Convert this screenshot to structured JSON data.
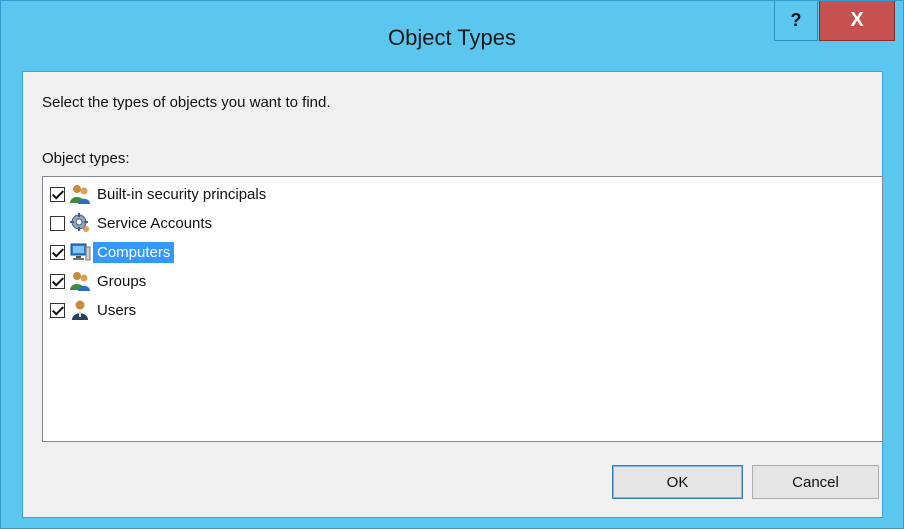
{
  "window": {
    "title": "Object Types",
    "help_label": "?",
    "close_label": "X"
  },
  "dialog": {
    "prompt": "Select the types of objects you want to find.",
    "list_label": "Object types:"
  },
  "object_types": [
    {
      "label": "Built-in security principals",
      "checked": true,
      "selected": false,
      "icon": "users-group-icon"
    },
    {
      "label": "Service Accounts",
      "checked": false,
      "selected": false,
      "icon": "service-account-gear-icon"
    },
    {
      "label": "Computers",
      "checked": true,
      "selected": true,
      "icon": "computer-icon"
    },
    {
      "label": "Groups",
      "checked": true,
      "selected": false,
      "icon": "users-group-icon"
    },
    {
      "label": "Users",
      "checked": true,
      "selected": false,
      "icon": "user-icon"
    }
  ],
  "buttons": {
    "ok": "OK",
    "cancel": "Cancel"
  },
  "colors": {
    "frame": "#5bc6ee",
    "close": "#c75050",
    "selection": "#3399ff"
  }
}
